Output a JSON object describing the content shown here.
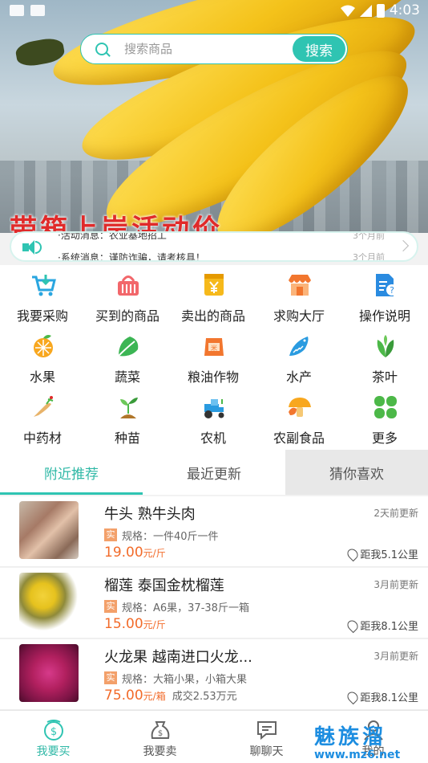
{
  "status_bar": {
    "time": "4:03"
  },
  "banner": {
    "promo_text": "带箱上岸活动价"
  },
  "search": {
    "placeholder": "搜索商品",
    "button_label": "搜索"
  },
  "notice": {
    "items": [
      {
        "text": "·活动消息：农业基地招工",
        "time": "3个月前"
      },
      {
        "text": "·系统消息：谨防诈骗，请考核具！",
        "time": "3个月前"
      }
    ]
  },
  "categories": [
    {
      "label": "我要采购",
      "icon": "cart-icon"
    },
    {
      "label": "买到的商品",
      "icon": "basket-icon"
    },
    {
      "label": "卖出的商品",
      "icon": "money-box-icon"
    },
    {
      "label": "求购大厅",
      "icon": "shop-icon"
    },
    {
      "label": "操作说明",
      "icon": "help-doc-icon"
    },
    {
      "label": "水果",
      "icon": "orange-icon"
    },
    {
      "label": "蔬菜",
      "icon": "vegetable-icon"
    },
    {
      "label": "粮油作物",
      "icon": "rice-bag-icon"
    },
    {
      "label": "水产",
      "icon": "fish-icon"
    },
    {
      "label": "茶叶",
      "icon": "tea-leaf-icon"
    },
    {
      "label": "中药材",
      "icon": "ginseng-icon"
    },
    {
      "label": "种苗",
      "icon": "seedling-icon"
    },
    {
      "label": "农机",
      "icon": "tractor-icon"
    },
    {
      "label": "农副食品",
      "icon": "mushroom-icon"
    },
    {
      "label": "更多",
      "icon": "clover-icon"
    }
  ],
  "tabs": [
    {
      "label": "附近推荐"
    },
    {
      "label": "最近更新"
    },
    {
      "label": "猜你喜欢"
    }
  ],
  "products": [
    {
      "title": "牛头 熟牛头肉",
      "time": "2天前更新",
      "tag": "实",
      "spec": "规格：一件40斤一件",
      "price": "19.00",
      "unit": "元/斤",
      "deal": "",
      "distance": "距我5.1公里"
    },
    {
      "title": "榴莲 泰国金枕榴莲",
      "time": "3月前更新",
      "tag": "实",
      "spec": "规格：A6果，37-38斤一箱",
      "price": "15.00",
      "unit": "元/斤",
      "deal": "",
      "distance": "距我8.1公里"
    },
    {
      "title": "火龙果 越南进口火龙...",
      "time": "3月前更新",
      "tag": "实",
      "spec": "规格：大箱小果，小箱大果",
      "price": "75.00",
      "unit": "元/箱",
      "deal": "成交2.53万元",
      "distance": "距我8.1公里"
    }
  ],
  "bottom_nav": [
    {
      "label": "我要买",
      "icon": "buy-coin-icon"
    },
    {
      "label": "我要卖",
      "icon": "sell-bag-icon"
    },
    {
      "label": "聊聊天",
      "icon": "chat-icon"
    },
    {
      "label": "我的",
      "icon": "user-icon"
    }
  ],
  "watermark": {
    "line1": "魅族溜",
    "line2": "www.mz6.net"
  },
  "colors": {
    "accent": "#2fc4b2",
    "price": "#f26b2a",
    "watermark": "#1c8de0"
  }
}
